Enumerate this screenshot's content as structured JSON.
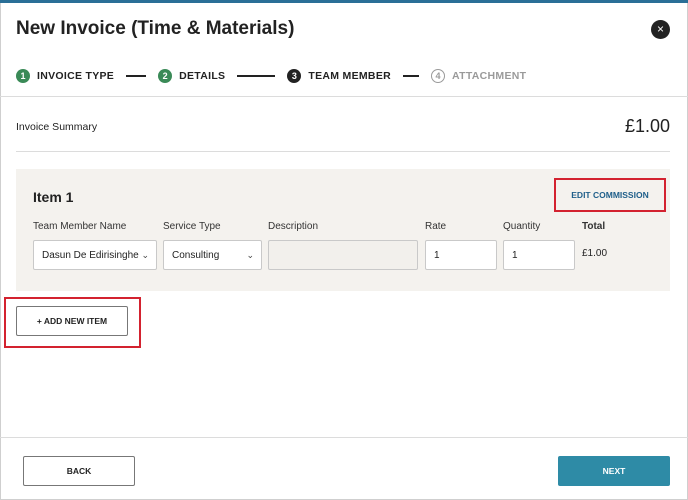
{
  "dialog": {
    "title": "New Invoice (Time & Materials)",
    "close_glyph": "×"
  },
  "stepper": {
    "steps": [
      {
        "number": "1",
        "label": "INVOICE TYPE",
        "state": "done"
      },
      {
        "number": "2",
        "label": "DETAILS",
        "state": "done"
      },
      {
        "number": "3",
        "label": "TEAM MEMBER",
        "state": "active"
      },
      {
        "number": "4",
        "label": "ATTACHMENT",
        "state": "pending"
      }
    ]
  },
  "summary": {
    "label": "Invoice Summary",
    "amount": "£1.00"
  },
  "item": {
    "title": "Item 1",
    "edit_commission": "EDIT COMMISSION",
    "columns": {
      "team_member": "Team Member Name",
      "service_type": "Service Type",
      "description": "Description",
      "rate": "Rate",
      "quantity": "Quantity",
      "total": "Total"
    },
    "values": {
      "team_member": "Dasun De Edirisinghe",
      "service_type": "Consulting",
      "description": "",
      "rate": "1",
      "quantity": "1",
      "total": "£1.00"
    }
  },
  "actions": {
    "add_item": "+ ADD NEW ITEM",
    "back": "BACK",
    "next": "NEXT"
  },
  "colors": {
    "accent_teal": "#2e8ba6",
    "step_done": "#3a8a57",
    "highlight_red": "#d3222f",
    "card_bg": "#f4f2ee"
  }
}
